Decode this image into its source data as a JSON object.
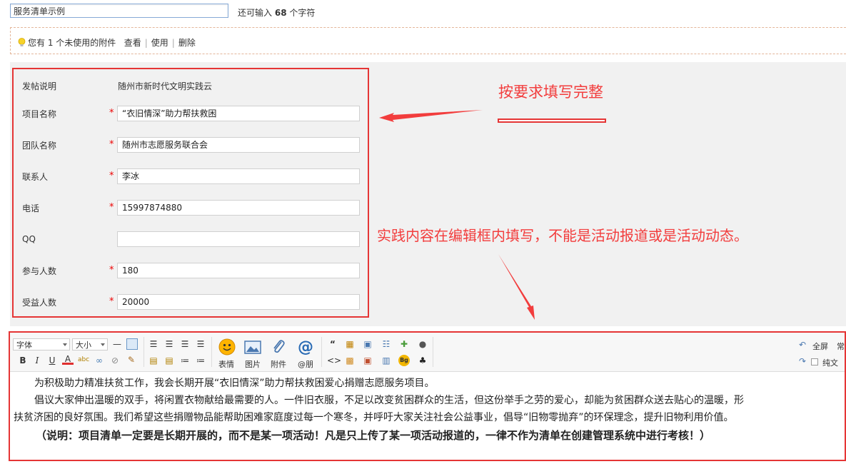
{
  "title": {
    "value": "服务清单示例",
    "remaining_prefix": "还可输入",
    "remaining_count": "68",
    "remaining_suffix": "个字符"
  },
  "attachment": {
    "notice": "您有 1 个未使用的附件",
    "view": "查看",
    "use": "使用",
    "delete": "删除"
  },
  "form": {
    "intro_label": "发帖说明",
    "intro_value": "随州市新时代文明实践云",
    "rows": [
      {
        "label": "项目名称",
        "value": "“衣旧情深”助力帮扶救困",
        "required": "*"
      },
      {
        "label": "团队名称",
        "value": "随州市志愿服务联合会",
        "required": "*"
      },
      {
        "label": "联系人",
        "value": "李冰",
        "required": "*"
      },
      {
        "label": "电话",
        "value": "15997874880",
        "required": "*"
      },
      {
        "label": "QQ",
        "value": "",
        "required": ""
      },
      {
        "label": "参与人数",
        "value": "180",
        "required": "*"
      },
      {
        "label": "受益人数",
        "value": "20000",
        "required": "*"
      }
    ]
  },
  "annotations": {
    "a1": "按要求填写完整",
    "a2": "实践内容在编辑框内填写，不能是活动报道或是活动动态。"
  },
  "toolbar": {
    "font": "字体",
    "size": "大小",
    "emoji": "表情",
    "image": "图片",
    "attach": "附件",
    "at": "@朋",
    "fullscreen": "全屏",
    "plaintext": "纯文",
    "more": "常"
  },
  "content": {
    "p1": "为积极助力精准扶贫工作，我会长期开展“衣旧情深”助力帮扶救困爱心捐赠志愿服务项目。",
    "p2": "倡议大家伸出温暖的双手，将闲置衣物献给最需要的人。一件旧衣服，不足以改变贫困群众的生活，但这份举手之劳的爱心，却能为贫困群众送去贴心的温暖，形",
    "p3": "扶贫济困的良好氛围。我们希望这些捐赠物品能帮助困难家庭度过每一个寒冬，并呼吁大家关注社会公益事业，倡导“旧物零抛弃”的环保理念，提升旧物利用价值。",
    "p4": "（说明：项目清单一定要是长期开展的，而不是某一项活动！凡是只上传了某一项活动报道的，一律不作为清单在创建管理系统中进行考核！）"
  },
  "colors": {
    "accent_red": "#e53535",
    "annotation_red": "#f23d3d",
    "input_border": "#86a9d6"
  }
}
